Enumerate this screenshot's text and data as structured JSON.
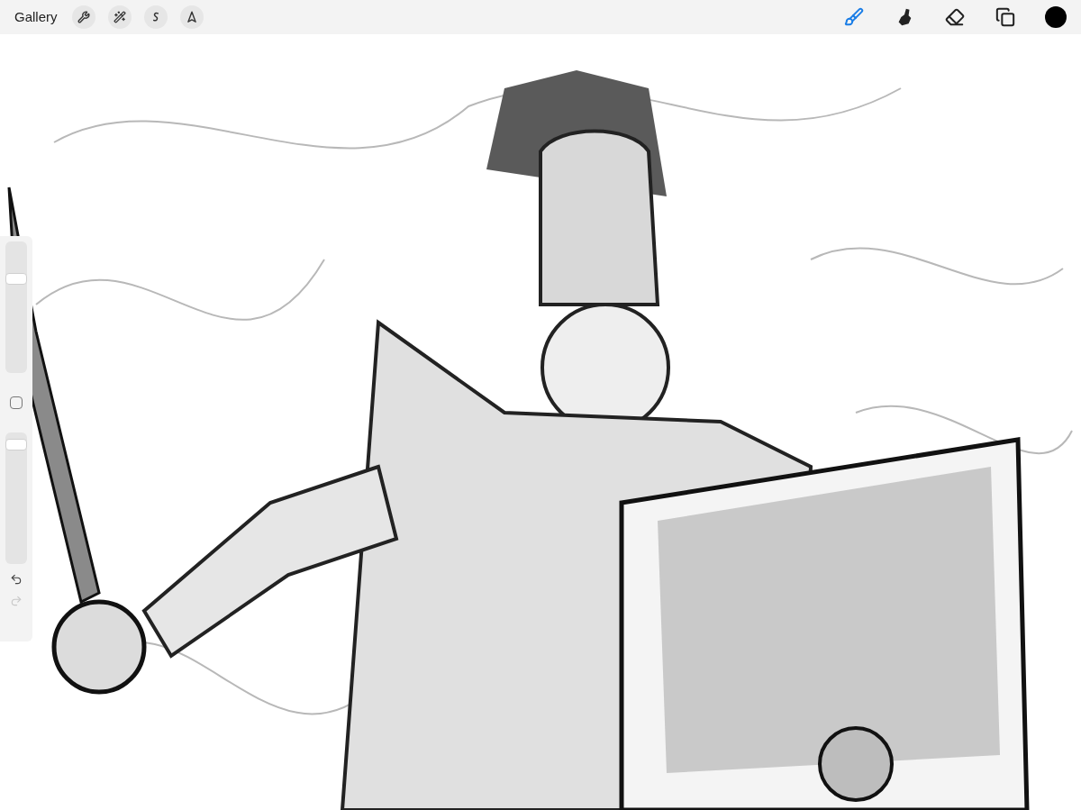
{
  "toolbar": {
    "gallery": "Gallery",
    "left_tools": [
      {
        "kind": "actions",
        "selected": false
      },
      {
        "kind": "adjustments",
        "selected": false
      },
      {
        "kind": "selection",
        "selected": false
      },
      {
        "kind": "transform",
        "selected": false
      }
    ],
    "right_tools": [
      {
        "kind": "brush",
        "selected": true
      },
      {
        "kind": "smudge",
        "selected": false
      },
      {
        "kind": "eraser",
        "selected": false
      },
      {
        "kind": "layers",
        "selected": false
      }
    ],
    "color": "#000000"
  },
  "sidebar": {
    "size": {
      "level": 0.74
    },
    "opacity": {
      "level": 0.95
    },
    "undo": {
      "disabled": false
    },
    "redo": {
      "disabled": true
    }
  }
}
